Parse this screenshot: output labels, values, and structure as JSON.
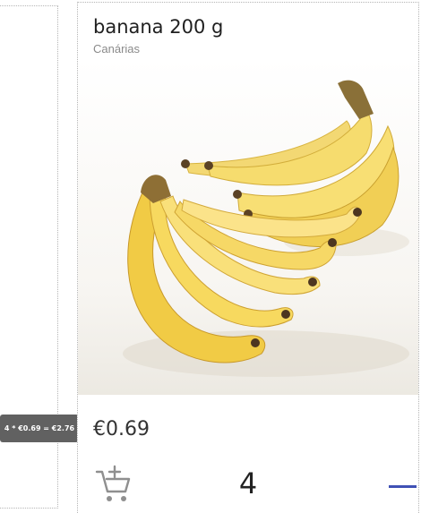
{
  "tooltip": {
    "text": "4 * €0.69 = €2.76"
  },
  "product": {
    "name": "banana 200 g",
    "origin": "Canárias",
    "price": "€0.69",
    "quantity": "4",
    "image_subject": "bunch of bananas"
  },
  "icons": {
    "cart": "add-shopping-cart-icon",
    "decrement": "minus-icon"
  },
  "colors": {
    "accent": "#3f51b5",
    "tooltip_bg": "#616161"
  }
}
